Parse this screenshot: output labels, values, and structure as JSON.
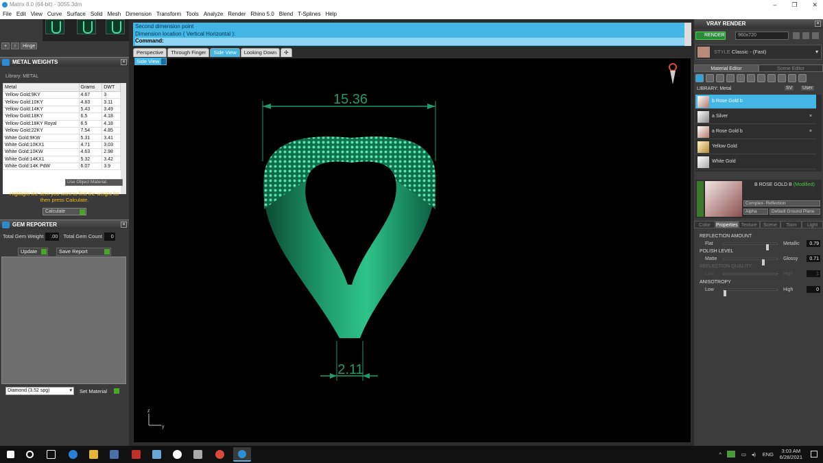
{
  "window": {
    "title": "Matrix 8.0 (64-bit) - 3055.3dm"
  },
  "menu": [
    "File",
    "Edit",
    "View",
    "Curve",
    "Surface",
    "Solid",
    "Mesh",
    "Dimension",
    "Transform",
    "Tools",
    "Analyze",
    "Render",
    "Rhino 5.0",
    "Blend",
    "T-Splines",
    "Help"
  ],
  "toolbar_small": {
    "b1": "+",
    "b2": "↑",
    "b3": "Hinge"
  },
  "metal_weights": {
    "title": "METAL WEIGHTS",
    "library": "Library: METAL",
    "headers": [
      "Metal",
      "Grams",
      "DWT"
    ],
    "rows": [
      [
        "Yellow Gold:9KY",
        "4.67",
        "3"
      ],
      [
        "Yellow Gold:10KY",
        "4.83",
        "3.11"
      ],
      [
        "Yellow Gold:14KY",
        "5.43",
        "3.49"
      ],
      [
        "Yellow Gold:18KY",
        "6.5",
        "4.18"
      ],
      [
        "Yellow Gold:18KY Royal",
        "6.5",
        "4.18"
      ],
      [
        "Yellow Gold:22KY",
        "7.54",
        "4.85"
      ],
      [
        "White Gold:9KW",
        "5.31",
        "3.41"
      ],
      [
        "White Gold:10KX1",
        "4.71",
        "3.03"
      ],
      [
        "White Gold:10KW",
        "4.63",
        "2.98"
      ],
      [
        "White Gold:14KX1",
        "5.32",
        "3.42"
      ],
      [
        "White Gold:14K PdW",
        "6.07",
        "3.9"
      ]
    ],
    "use_object_material": "Use Object Material",
    "hint": "Highlight the item you want to find the weight for then press Calculate.",
    "calculate": "Calculate"
  },
  "gem_reporter": {
    "title": "GEM REPORTER",
    "total_gem_weight_label": "Total Gem Weight",
    "total_gem_weight": ".00",
    "total_gem_count_label": "Total Gem Count",
    "total_gem_count": "0",
    "update": "Update",
    "save_report": "Save Report",
    "gem_select": "Diamond      (3.52 spg)",
    "set_material": "Set Material"
  },
  "command": {
    "line1": "Second dimension point",
    "line2": "Dimension location ( Vertical  Horizontal ):",
    "prompt": "Command:"
  },
  "view_tabs": [
    "Perspective",
    "Through Finger",
    "Side View",
    "Looking Down"
  ],
  "active_view_label": "Side View",
  "dimensions": {
    "top": "15.36",
    "bottom": "2.11"
  },
  "axis": {
    "z": "z",
    "y": "y"
  },
  "vray": {
    "title": "VRAY RENDER",
    "render": "RENDER",
    "resolution": "960x720",
    "style_label": "STYLE",
    "style": "Classic - (Fast)",
    "tabs": [
      "Material Editor",
      "Scene Editor"
    ],
    "library": "LIBRARY: Metal",
    "lib_btns": [
      "SV",
      "User"
    ],
    "materials": [
      "b Rose Gold b",
      "a Silver",
      "a Rose Gold b",
      "Yellow Gold",
      "White Gold"
    ],
    "preview_name": "B ROSE GOLD B",
    "preview_modified": "(Modified)",
    "preview_type": "Complex- Reflection",
    "alpha": "Alpha",
    "ground": "Default Ground Plane",
    "prop_tabs": [
      "Color",
      "Properties",
      "Texture",
      "Scene",
      "Toon",
      "Light"
    ],
    "reflection": {
      "label": "REFLECTION AMOUNT",
      "min": "Flat",
      "max": "Metallic",
      "value": "0.79"
    },
    "polish": {
      "label": "POLISH LEVEL",
      "min": "Matte",
      "max": "Glossy",
      "value": "0.71"
    },
    "reflection_quality": {
      "label": "REFLECTION QUALITY",
      "min": "Low",
      "max": "High",
      "value": "1"
    },
    "anisotropy": {
      "label": "ANISOTROPY",
      "min": "Low",
      "max": "High",
      "value": "0"
    }
  },
  "taskbar": {
    "lang": "ENG",
    "time": "3:03 AM",
    "date": "6/28/2021"
  }
}
